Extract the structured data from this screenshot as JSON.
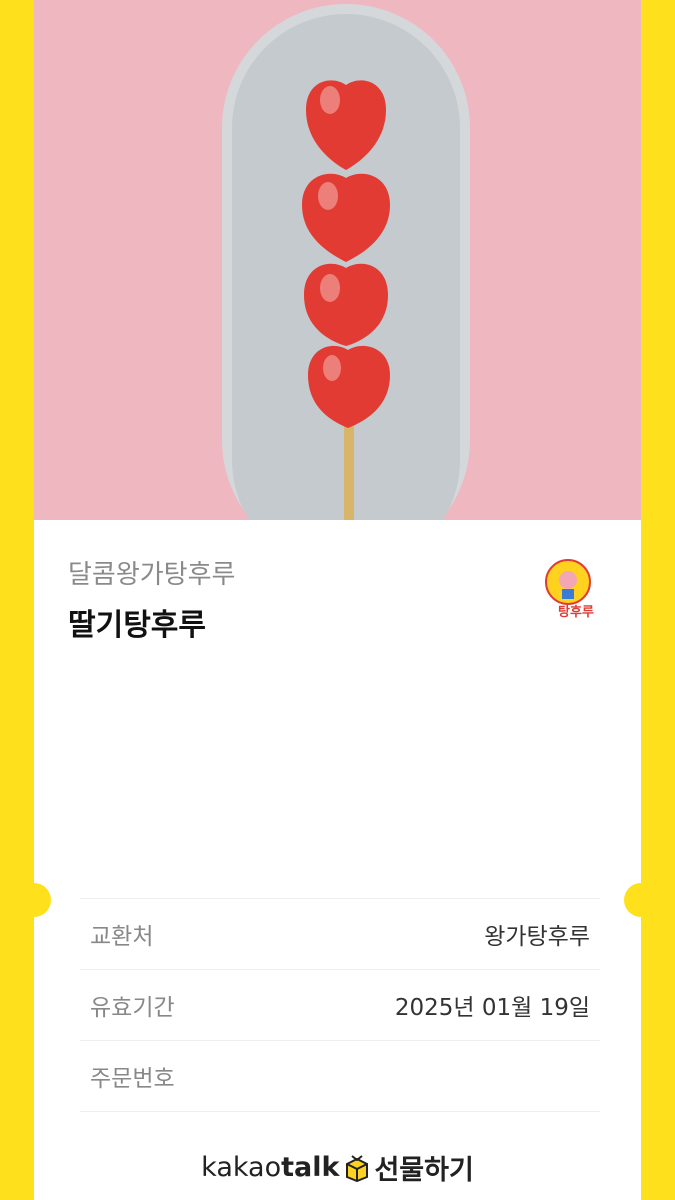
{
  "gift": {
    "brand": "달콤왕가탕후루",
    "product": "딸기탕후루",
    "logo_text": "탕후루"
  },
  "info": {
    "rows": [
      {
        "key": "교환처",
        "value": "왕가탕후루"
      },
      {
        "key": "유효기간",
        "value": "2025년 01월 19일"
      },
      {
        "key": "주문번호",
        "value": ""
      }
    ]
  },
  "footer": {
    "kakao": "kakao",
    "talk": "talk",
    "gift_label": "선물하기",
    "icon": "gift-box-icon"
  },
  "colors": {
    "frame": "#FFE01C",
    "hero_bg": "#EFB8C1",
    "strawberry": "#E23B33"
  }
}
